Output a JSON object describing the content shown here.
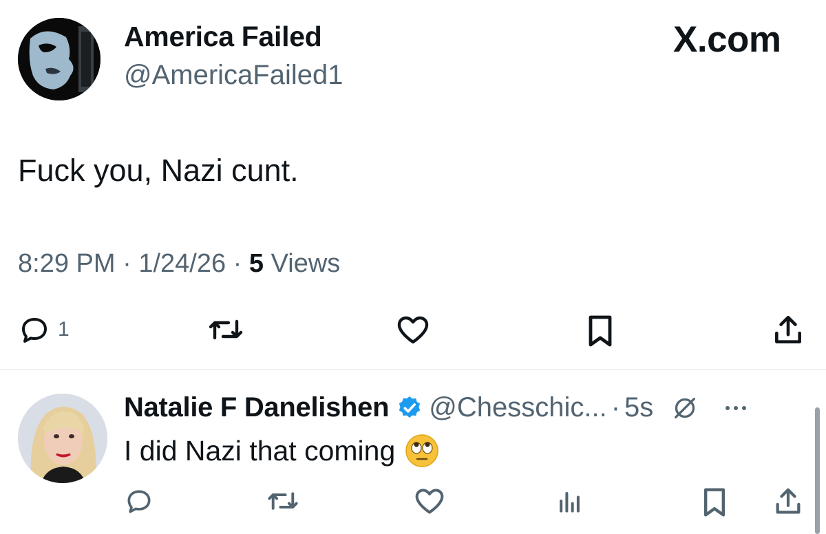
{
  "tweet": {
    "author_name": "America Failed",
    "author_handle": "@AmericaFailed1",
    "brand": "X.com",
    "text": "Fuck you, Nazi cunt.",
    "time": "8:29 PM",
    "date": "1/24/26",
    "views_count": "5",
    "views_label": "Views",
    "reply_count": "1",
    "icons": [
      "reply-icon",
      "retweet-icon",
      "like-icon",
      "bookmark-icon",
      "share-icon"
    ]
  },
  "reply": {
    "author_name": "Natalie F Danelishen",
    "verified": true,
    "handle": "@Chesschic...",
    "time": "5s",
    "text": "I did Nazi that coming",
    "emoji": "face-with-rolling-eyes",
    "icons": [
      "reply-icon",
      "retweet-icon",
      "like-icon",
      "views-icon",
      "bookmark-icon",
      "share-icon"
    ]
  },
  "colors": {
    "text_primary": "#0f1419",
    "text_secondary": "#536471",
    "verified_blue": "#1d9bf0",
    "divider": "#eff3f4"
  }
}
